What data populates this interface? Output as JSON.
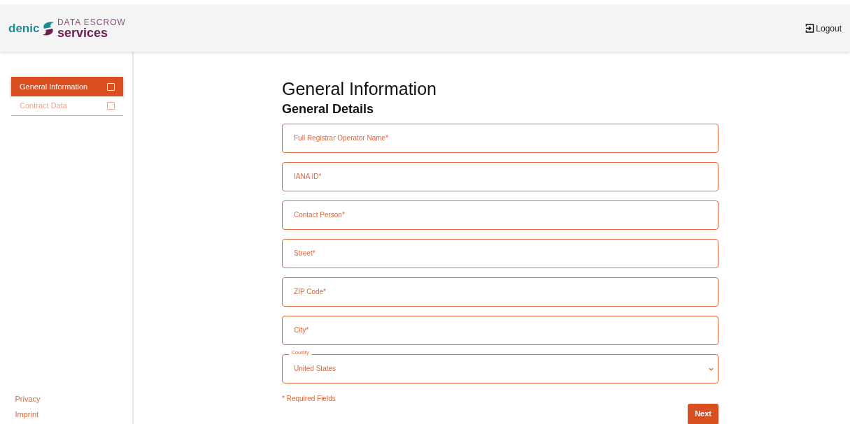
{
  "header": {
    "logo": {
      "brand": "denic",
      "line_1": "DATA ESCROW",
      "line_2": "services"
    },
    "logout": "Logout"
  },
  "sidebar": {
    "items": [
      {
        "label": "General Information",
        "selected": true,
        "checked": false
      },
      {
        "label": "Contract Data",
        "selected": false,
        "checked": false
      }
    ],
    "footer_links": [
      "Privacy",
      "Imprint"
    ]
  },
  "main": {
    "title": "General Information",
    "subtitle": "General Details",
    "fields": [
      {
        "kind": "text",
        "placeholder": "Full Registrar Operator Name*"
      },
      {
        "kind": "text",
        "placeholder": "IANA ID*"
      },
      {
        "kind": "text",
        "placeholder": "Contact Person*"
      },
      {
        "kind": "text",
        "placeholder": "Street*"
      },
      {
        "kind": "text",
        "placeholder": "ZIP Code*"
      },
      {
        "kind": "text",
        "placeholder": "City*"
      },
      {
        "kind": "select",
        "label": "Country",
        "value": "United States"
      }
    ],
    "note": "* Required Fields",
    "next_button": "Next"
  }
}
